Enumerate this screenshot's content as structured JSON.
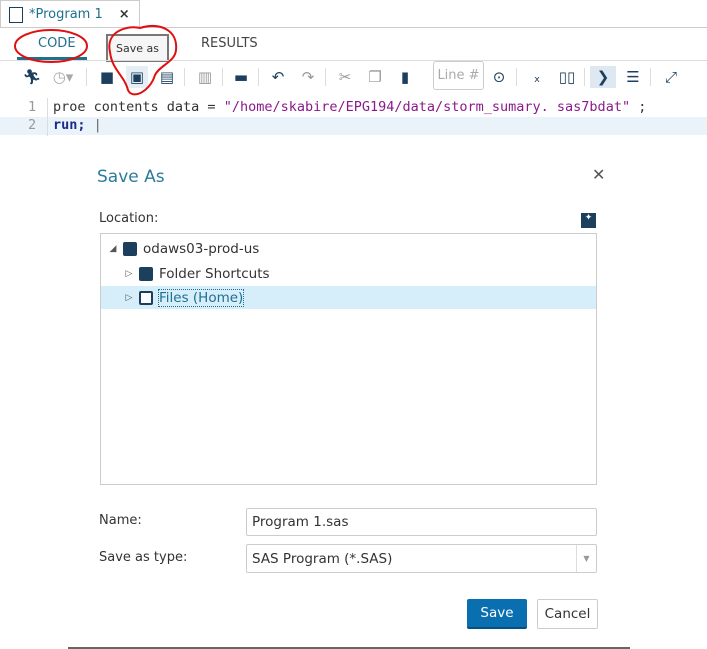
{
  "tab": {
    "title": "*Program 1",
    "close": "×"
  },
  "subtabs": {
    "code": "CODE",
    "results": "RESULTS"
  },
  "tooltip": "Save as",
  "toolbar": {
    "line_placeholder": "Line #"
  },
  "editor": {
    "lines": [
      {
        "num": "1",
        "parts": [
          {
            "t": "proe contents data = ",
            "c": "#333"
          },
          {
            "t": "\"/home/skabire/EPG194/data/storm_sumary. sas7bdat\"",
            "c": "#8a1a8a"
          },
          {
            "t": " ;",
            "c": "#333"
          }
        ]
      },
      {
        "num": "2",
        "parts": [
          {
            "t": "run;",
            "c": "#1a2a8a"
          }
        ]
      }
    ]
  },
  "dialog": {
    "title": "Save As",
    "close": "✕",
    "location_label": "Location:",
    "tree": [
      {
        "label": "odaws03-prod-us"
      },
      {
        "label": "Folder Shortcuts"
      },
      {
        "label": "Files (Home)",
        "selected": true
      }
    ],
    "name_label": "Name:",
    "name_value": "Program 1.sas",
    "type_label": "Save as type:",
    "type_value": "SAS Program (*.SAS)",
    "save": "Save",
    "cancel": "Cancel"
  },
  "colors": {
    "accent": "#2a7b9b",
    "primary_button": "#0a6fb0",
    "selection": "#d6eefa",
    "annotation": "#e01010"
  }
}
